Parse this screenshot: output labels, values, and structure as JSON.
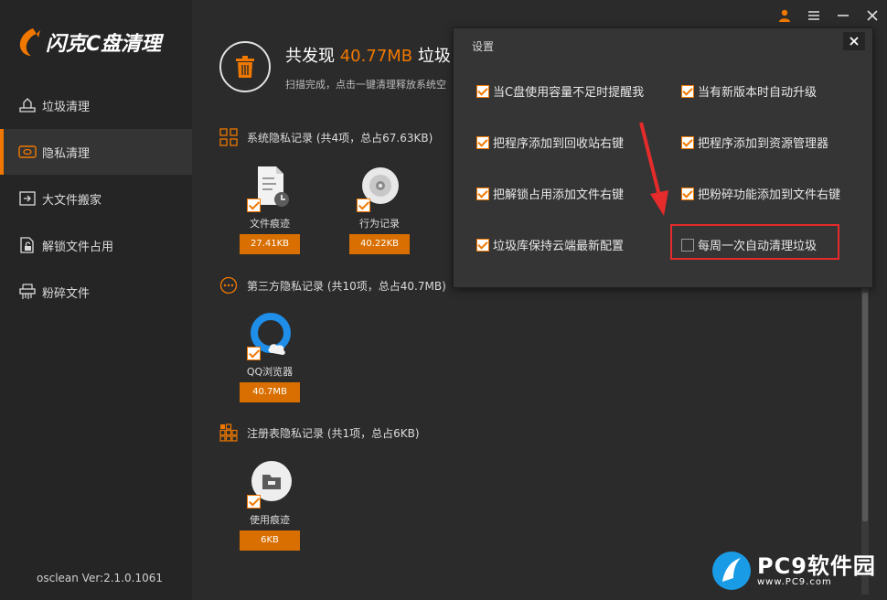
{
  "app": {
    "logo_text": "闪克C盘清理",
    "version": "osclean Ver:2.1.0.1061"
  },
  "sidebar": {
    "items": [
      {
        "label": "垃圾清理",
        "icon": "broom-icon",
        "active": false
      },
      {
        "label": "隐私清理",
        "icon": "privacy-icon",
        "active": true
      },
      {
        "label": "大文件搬家",
        "icon": "move-file-icon",
        "active": false
      },
      {
        "label": "解锁文件占用",
        "icon": "unlock-file-icon",
        "active": false
      },
      {
        "label": "粉碎文件",
        "icon": "shredder-icon",
        "active": false
      }
    ]
  },
  "header": {
    "prefix": "共发现 ",
    "amount": "40.77MB",
    "suffix": " 垃圾",
    "subtitle": "扫描完成，点击一键清理释放系统空"
  },
  "sections": [
    {
      "title": "系统隐私记录 (共4项，总占67.63KB)",
      "items": [
        {
          "label": "文件痕迹",
          "size": "27.41KB",
          "icon": "file-trace-icon"
        },
        {
          "label": "行为记录",
          "size": "40.22KB",
          "icon": "disc-icon"
        }
      ]
    },
    {
      "title": "第三方隐私记录 (共10项，总占40.7MB)",
      "items": [
        {
          "label": "QQ浏览器",
          "size": "40.7MB",
          "icon": "qq-browser-icon"
        }
      ]
    },
    {
      "title": "注册表隐私记录 (共1项，总占6KB)",
      "items": [
        {
          "label": "使用痕迹",
          "size": "6KB",
          "icon": "usage-trace-icon"
        }
      ]
    }
  ],
  "settings": {
    "title": "设置",
    "options": [
      {
        "label": "当C盘使用容量不足时提醒我",
        "checked": true
      },
      {
        "label": "当有新版本时自动升级",
        "checked": true
      },
      {
        "label": "把程序添加到回收站右键",
        "checked": true
      },
      {
        "label": "把程序添加到资源管理器",
        "checked": true
      },
      {
        "label": "把解锁占用添加文件右键",
        "checked": true
      },
      {
        "label": "把粉碎功能添加到文件右键",
        "checked": true
      },
      {
        "label": "垃圾库保持云端最新配置",
        "checked": true
      },
      {
        "label": "每周一次自动清理垃圾",
        "checked": false
      }
    ]
  },
  "watermark": {
    "brand": "PC9软件园",
    "url": "www.PC9.com"
  },
  "colors": {
    "accent": "#f07800",
    "highlight": "#e52b2b",
    "background": "#2b2b2b",
    "sidebar": "#252525"
  }
}
